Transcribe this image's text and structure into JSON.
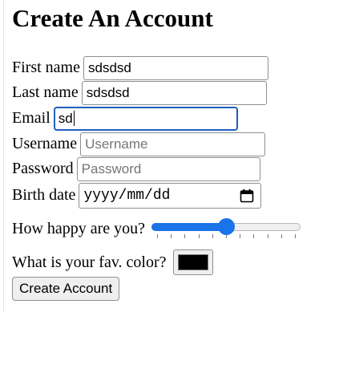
{
  "heading": "Create An Account",
  "fields": {
    "first_name": {
      "label": "First name",
      "value": "sdsdsd"
    },
    "last_name": {
      "label": "Last name",
      "value": "sdsdsd"
    },
    "email": {
      "label": "Email",
      "value": "sd"
    },
    "username": {
      "label": "Username",
      "placeholder": "Username"
    },
    "password": {
      "label": "Password",
      "placeholder": "Password"
    },
    "birth_date": {
      "label": "Birth date",
      "placeholder": "yyyy/mm/dd"
    },
    "happiness": {
      "label": "How happy are you?",
      "level_fraction": 0.5,
      "tick_count": 11
    },
    "fav_color": {
      "label": "What is your fav. color?",
      "value": "#000000"
    }
  },
  "submit": {
    "label": "Create Account"
  },
  "colors": {
    "accent": "#1a73e8",
    "focus_border": "#1f5fbf"
  },
  "icons": {
    "date_picker": "calendar-icon"
  }
}
